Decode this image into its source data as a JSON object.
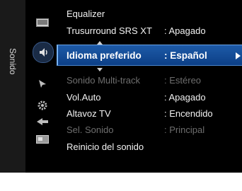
{
  "side_tab": {
    "label": "Sonido"
  },
  "menu": {
    "items": [
      {
        "label": "Equalizer",
        "value": "",
        "state": "normal"
      },
      {
        "label": "Trusurround SRS XT",
        "value": ": Apagado",
        "state": "normal"
      },
      {
        "label": "Idioma preferido",
        "value": ": Español",
        "state": "selected"
      },
      {
        "label": "Sonido Multi-track",
        "value": ": Estéreo",
        "state": "disabled"
      },
      {
        "label": "Vol.Auto",
        "value": ": Apagado",
        "state": "normal"
      },
      {
        "label": "Altavoz TV",
        "value": ": Encendido",
        "state": "normal"
      },
      {
        "label": "Sel. Sonido",
        "value": ": Principal",
        "state": "disabled"
      },
      {
        "label": "Reinicio del sonido",
        "value": "",
        "state": "normal"
      }
    ]
  },
  "icons": [
    "picture-icon",
    "sound-icon",
    "channel-icon",
    "setup-icon",
    "input-icon",
    "application-icon"
  ],
  "colors": {
    "highlight": "#1d5aa8",
    "text": "#f2f2f2",
    "disabled_text": "#6e6e6e",
    "background": "#000000"
  }
}
